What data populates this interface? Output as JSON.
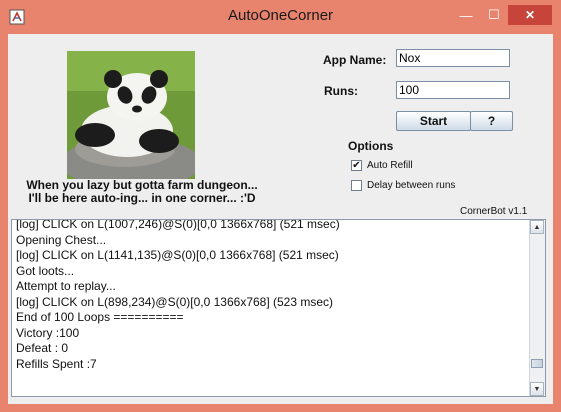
{
  "window": {
    "title": "AutoOneCorner",
    "minimize_glyph": "—",
    "maximize_glyph": "☐",
    "close_glyph": "✕"
  },
  "image": {
    "subject": "panda-photo",
    "caption_line1": "When you lazy but gotta farm dungeon...",
    "caption_line2": "I'll be here auto-ing... in one corner... :'D"
  },
  "form": {
    "app_name_label": "App Name:",
    "app_name_value": "Nox",
    "runs_label": "Runs:",
    "runs_value": "100",
    "start_label": "Start",
    "help_label": "?"
  },
  "options": {
    "title": "Options",
    "items": [
      {
        "label": "Auto Refill",
        "checked": true
      },
      {
        "label": "Delay between runs",
        "checked": false
      }
    ]
  },
  "version": "CornerBot v1.1",
  "log": {
    "lines": [
      "[log] CLICK on L(1007,246)@S(0)[0,0 1366x768] (521 msec)",
      "Opening Chest...",
      "[log] CLICK on L(1141,135)@S(0)[0,0 1366x768] (521 msec)",
      "Got loots...",
      "Attempt to replay...",
      "[log] CLICK on L(898,234)@S(0)[0,0 1366x768] (523 msec)",
      "End of 100 Loops ==========",
      "Victory :100",
      "Defeat : 0",
      "Refills Spent :7"
    ]
  },
  "colors": {
    "titlebar": "#e8836e",
    "close_button": "#c7443a",
    "client_bg": "#eeeeee"
  }
}
